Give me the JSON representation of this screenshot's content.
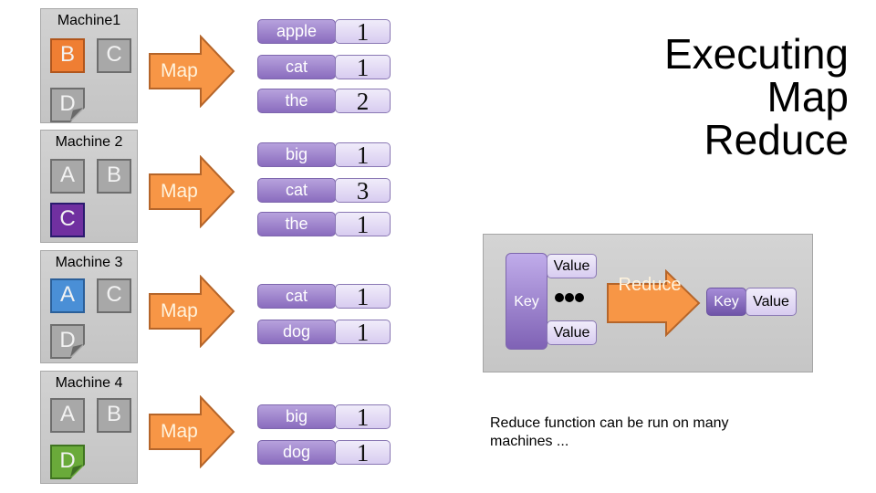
{
  "title": [
    "Executing",
    "Map",
    "Reduce"
  ],
  "colors": {
    "map_arrow": "#f79646",
    "map_arrow_border": "#b5652a",
    "key_purple": "#8a6cbe",
    "value_lavender": "#e4dcf4",
    "chunk_orange": "#ef7e33",
    "chunk_purple": "#7030a0",
    "chunk_blue": "#4a8fd6",
    "chunk_green": "#6aaa3a",
    "chunk_gray": "#a8a8a8"
  },
  "machines": [
    {
      "name": "Machine1",
      "chunks": [
        {
          "label": "B",
          "color": "orange"
        },
        {
          "label": "C",
          "color": "gray"
        },
        {
          "label": "D",
          "color": "gray",
          "folded": true
        }
      ],
      "map_label": "Map",
      "pairs": [
        {
          "key": "apple",
          "value": "1"
        },
        {
          "key": "cat",
          "value": "1"
        },
        {
          "key": "the",
          "value": "2"
        }
      ]
    },
    {
      "name": "Machine 2",
      "chunks": [
        {
          "label": "A",
          "color": "gray"
        },
        {
          "label": "B",
          "color": "gray"
        },
        {
          "label": "C",
          "color": "purple"
        }
      ],
      "map_label": "Map",
      "pairs": [
        {
          "key": "big",
          "value": "1"
        },
        {
          "key": "cat",
          "value": "3"
        },
        {
          "key": "the",
          "value": "1"
        }
      ]
    },
    {
      "name": "Machine 3",
      "chunks": [
        {
          "label": "A",
          "color": "blue"
        },
        {
          "label": "C",
          "color": "gray"
        },
        {
          "label": "D",
          "color": "gray",
          "folded": true
        }
      ],
      "map_label": "Map",
      "pairs": [
        {
          "key": "cat",
          "value": "1"
        },
        {
          "key": "dog",
          "value": "1"
        }
      ]
    },
    {
      "name": "Machine 4",
      "chunks": [
        {
          "label": "A",
          "color": "gray"
        },
        {
          "label": "B",
          "color": "gray"
        },
        {
          "label": "D",
          "color": "green",
          "folded": true
        }
      ],
      "map_label": "Map",
      "pairs": [
        {
          "key": "big",
          "value": "1"
        },
        {
          "key": "dog",
          "value": "1"
        }
      ]
    }
  ],
  "reduce_diagram": {
    "input_key": "Key",
    "input_values": [
      "Value",
      "Value"
    ],
    "ellipsis": "●●●",
    "arrow_label": "Reduce",
    "output_key": "Key",
    "output_value": "Value"
  },
  "note": "Reduce function can be run on many machines ..."
}
